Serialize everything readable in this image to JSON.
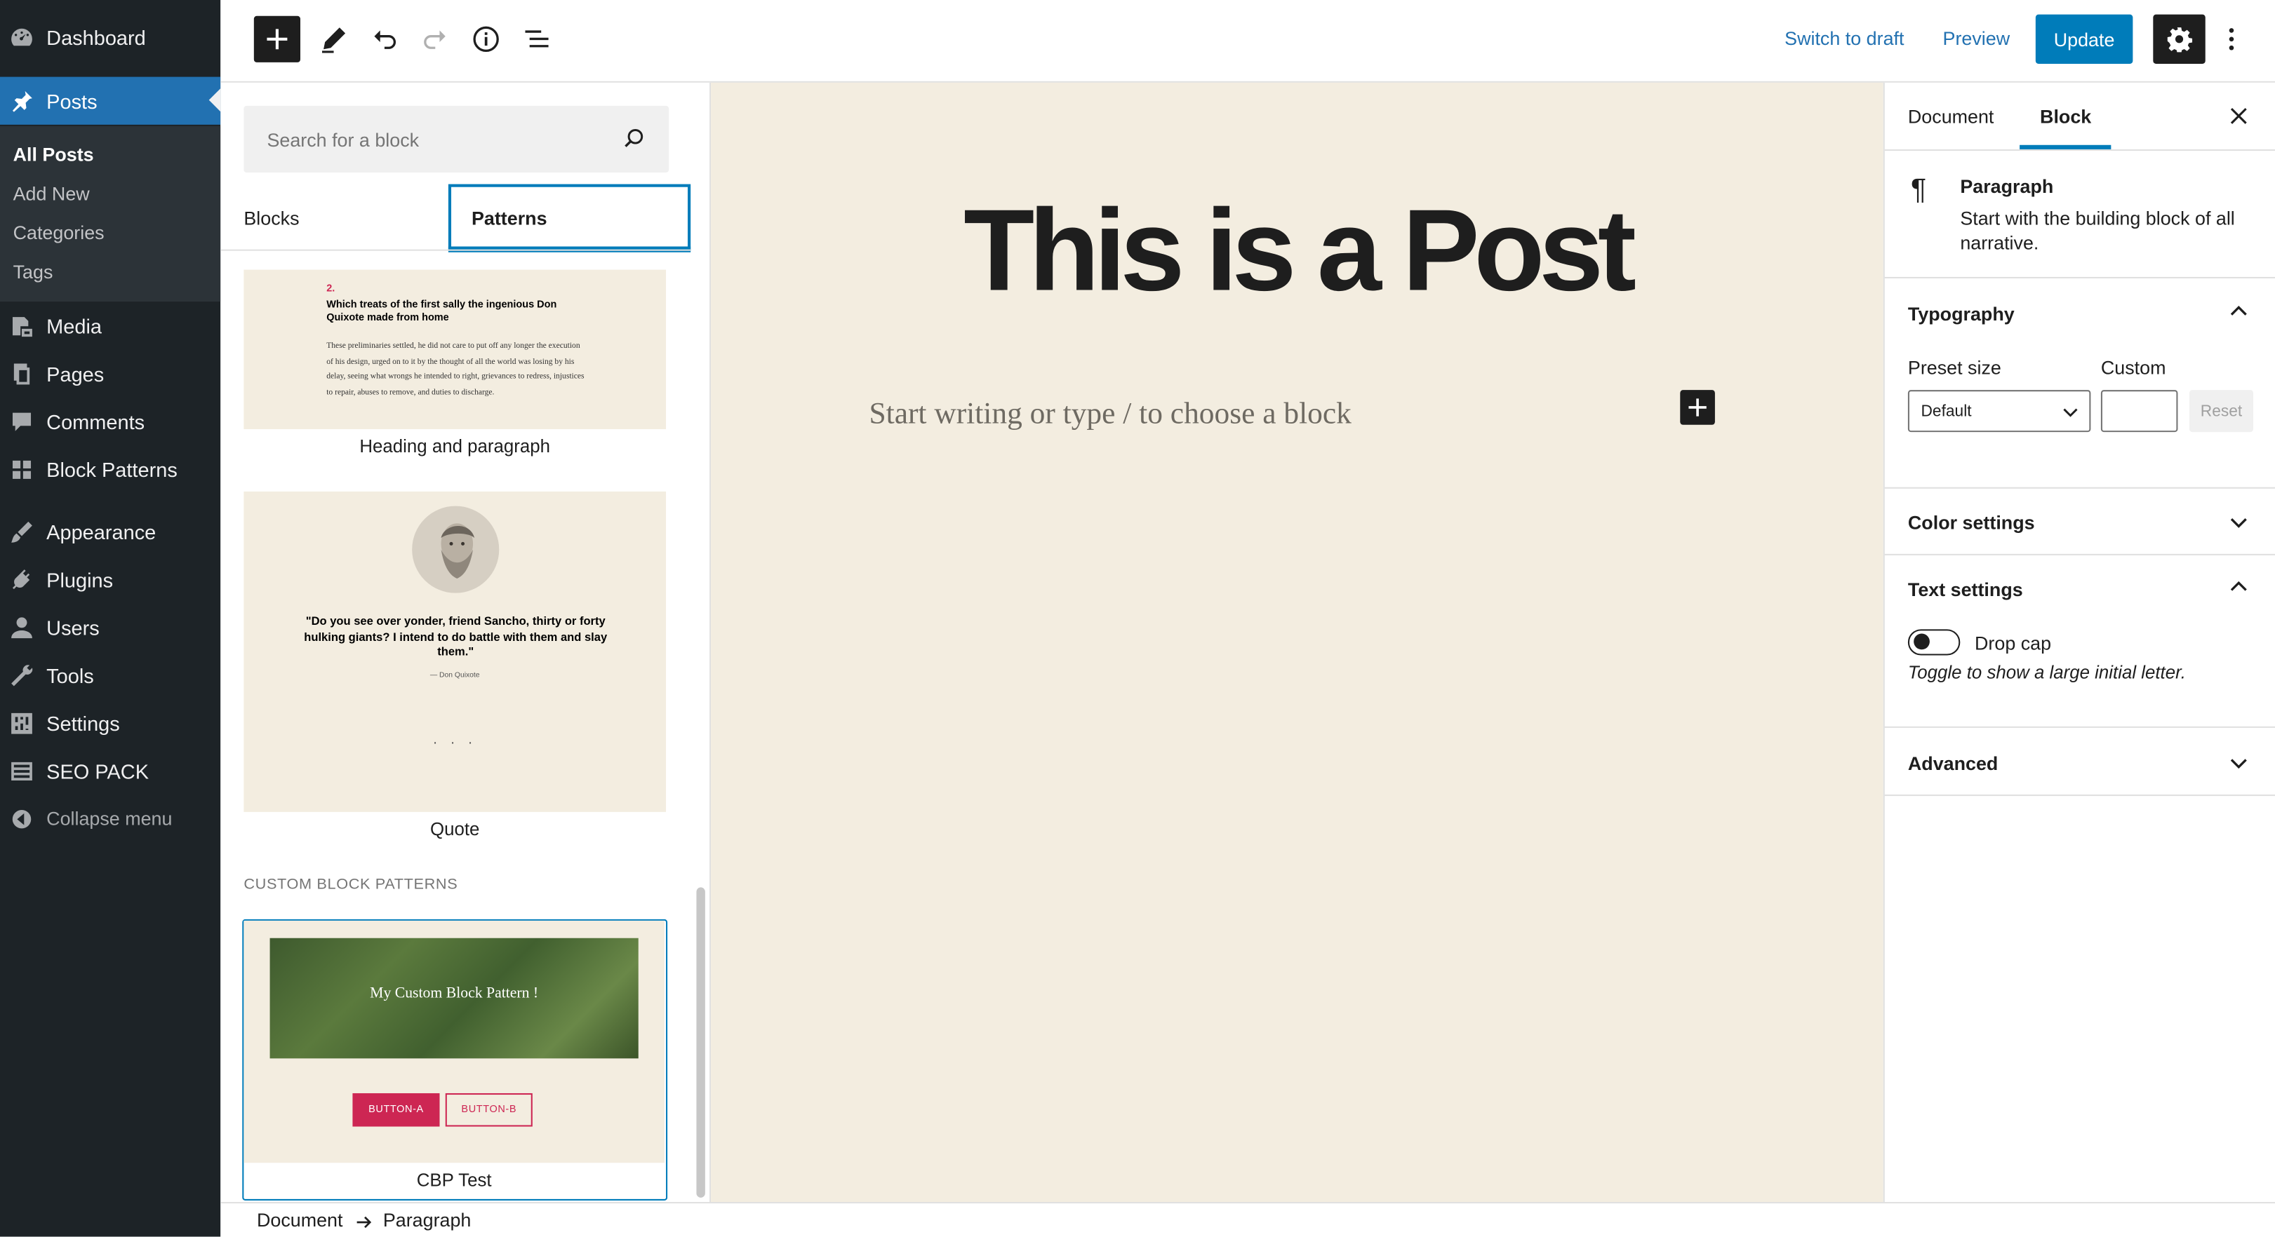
{
  "admin_menu": {
    "dashboard": "Dashboard",
    "posts": "Posts",
    "posts_submenu": [
      "All Posts",
      "Add New",
      "Categories",
      "Tags"
    ],
    "media": "Media",
    "pages": "Pages",
    "comments": "Comments",
    "block_patterns": "Block Patterns",
    "appearance": "Appearance",
    "plugins": "Plugins",
    "users": "Users",
    "tools": "Tools",
    "settings": "Settings",
    "seo_pack": "SEO PACK",
    "collapse": "Collapse menu"
  },
  "toolbar": {
    "switch_to_draft": "Switch to draft",
    "preview": "Preview",
    "update": "Update"
  },
  "inserter": {
    "search_placeholder": "Search for a block",
    "tabs": [
      "Blocks",
      "Patterns"
    ],
    "patterns": [
      {
        "label": "Heading and paragraph",
        "number": "2.",
        "heading": "Which treats of the first sally the ingenious Don Quixote made from home",
        "body": "These preliminaries settled, he did not care to put off any longer the execution of his design, urged on to it by the thought of all the world was losing by his delay, seeing what wrongs he intended to right, grievances to redress, injustices to repair, abuses to remove, and duties to discharge."
      },
      {
        "label": "Quote",
        "quote": "\"Do you see over yonder, friend Sancho, thirty or forty hulking giants? I intend to do battle with them and slay them.\"",
        "cite": "— Don Quixote",
        "dots": "· · ·"
      }
    ],
    "custom_section_title": "CUSTOM BLOCK PATTERNS",
    "custom_pattern": {
      "label": "CBP Test",
      "banner_text": "My Custom Block Pattern !",
      "button_a": "BUTTON-A",
      "button_b": "BUTTON-B"
    }
  },
  "canvas": {
    "title": "This is a Post",
    "placeholder": "Start writing or type / to choose a block"
  },
  "settings": {
    "tabs": [
      "Document",
      "Block"
    ],
    "block_name": "Paragraph",
    "block_description": "Start with the building block of all narrative.",
    "typography": {
      "title": "Typography",
      "preset_label": "Preset size",
      "custom_label": "Custom",
      "preset_value": "Default",
      "reset": "Reset"
    },
    "color_settings": "Color settings",
    "text_settings": {
      "title": "Text settings",
      "drop_cap": "Drop cap",
      "help": "Toggle to show a large initial letter."
    },
    "advanced": "Advanced"
  },
  "breadcrumb": [
    "Document",
    "Paragraph"
  ],
  "colors": {
    "admin_bg": "#1d2327",
    "accent": "#007cba",
    "canvas_bg": "#f3ede0",
    "pattern_red": "#cd2653"
  }
}
